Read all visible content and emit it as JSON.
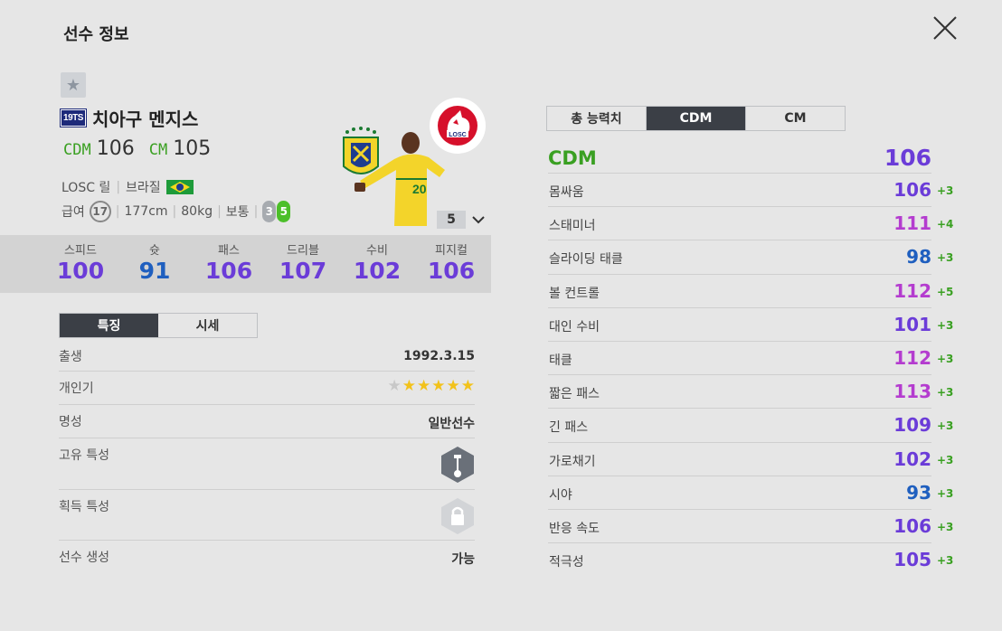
{
  "header": {
    "title": "선수 정보"
  },
  "player": {
    "season_badge": "19TS",
    "name": "치아구 멘지스",
    "positions": [
      {
        "code": "CDM",
        "ovr": "106"
      },
      {
        "code": "CM",
        "ovr": "105"
      }
    ],
    "club": "LOSC 릴",
    "nation": "브라질",
    "salary_label": "급여",
    "salary": "17",
    "height": "177cm",
    "weight": "80kg",
    "body_type": "보통",
    "weak_foot": "3",
    "strong_foot": "5",
    "enhance_level": "5",
    "club_logo_text": "LOSC",
    "jersey_number": "20"
  },
  "summary_stats": [
    {
      "label": "스피드",
      "value": "100",
      "color": "#6b3cd8"
    },
    {
      "label": "슛",
      "value": "91",
      "color": "#1f5fbf"
    },
    {
      "label": "패스",
      "value": "106",
      "color": "#6b3cd8"
    },
    {
      "label": "드리블",
      "value": "107",
      "color": "#6b3cd8"
    },
    {
      "label": "수비",
      "value": "102",
      "color": "#6b3cd8"
    },
    {
      "label": "피지컬",
      "value": "106",
      "color": "#6b3cd8"
    }
  ],
  "left_tabs": [
    "특징",
    "시세"
  ],
  "details": {
    "birth": {
      "label": "출생",
      "value": "1992.3.15"
    },
    "popularity": {
      "label": "개인기",
      "stars": 5,
      "max_stars": 6
    },
    "reputation": {
      "label": "명성",
      "value": "일반선수"
    },
    "unique_trait": {
      "label": "고유 특성"
    },
    "acquired_trait": {
      "label": "획득 특성"
    },
    "creation": {
      "label": "선수 생성",
      "value": "가능"
    }
  },
  "right_tabs": [
    "총 능력치",
    "CDM",
    "CM"
  ],
  "active_right_tab": 1,
  "attr_header": {
    "position": "CDM",
    "value": "106"
  },
  "attributes": [
    {
      "name": "몸싸움",
      "value": "106",
      "bonus": "+3",
      "color": "#6b3cd8"
    },
    {
      "name": "스태미너",
      "value": "111",
      "bonus": "+4",
      "color": "#b43ccf"
    },
    {
      "name": "슬라이딩 태클",
      "value": "98",
      "bonus": "+3",
      "color": "#1f5fbf"
    },
    {
      "name": "볼 컨트롤",
      "value": "112",
      "bonus": "+5",
      "color": "#b43ccf"
    },
    {
      "name": "대인 수비",
      "value": "101",
      "bonus": "+3",
      "color": "#6b3cd8"
    },
    {
      "name": "태클",
      "value": "112",
      "bonus": "+3",
      "color": "#b43ccf"
    },
    {
      "name": "짧은 패스",
      "value": "113",
      "bonus": "+3",
      "color": "#b43ccf"
    },
    {
      "name": "긴 패스",
      "value": "109",
      "bonus": "+3",
      "color": "#6b3cd8"
    },
    {
      "name": "가로채기",
      "value": "102",
      "bonus": "+3",
      "color": "#6b3cd8"
    },
    {
      "name": "시야",
      "value": "93",
      "bonus": "+3",
      "color": "#1f5fbf"
    },
    {
      "name": "반응 속도",
      "value": "106",
      "bonus": "+3",
      "color": "#6b3cd8"
    },
    {
      "name": "적극성",
      "value": "105",
      "bonus": "+3",
      "color": "#6b3cd8"
    }
  ],
  "colors": {
    "position_green": "#3aa022",
    "purple": "#6b3cd8",
    "magenta": "#b43ccf",
    "blue": "#1f5fbf",
    "dark_tab": "#3b3f46"
  }
}
